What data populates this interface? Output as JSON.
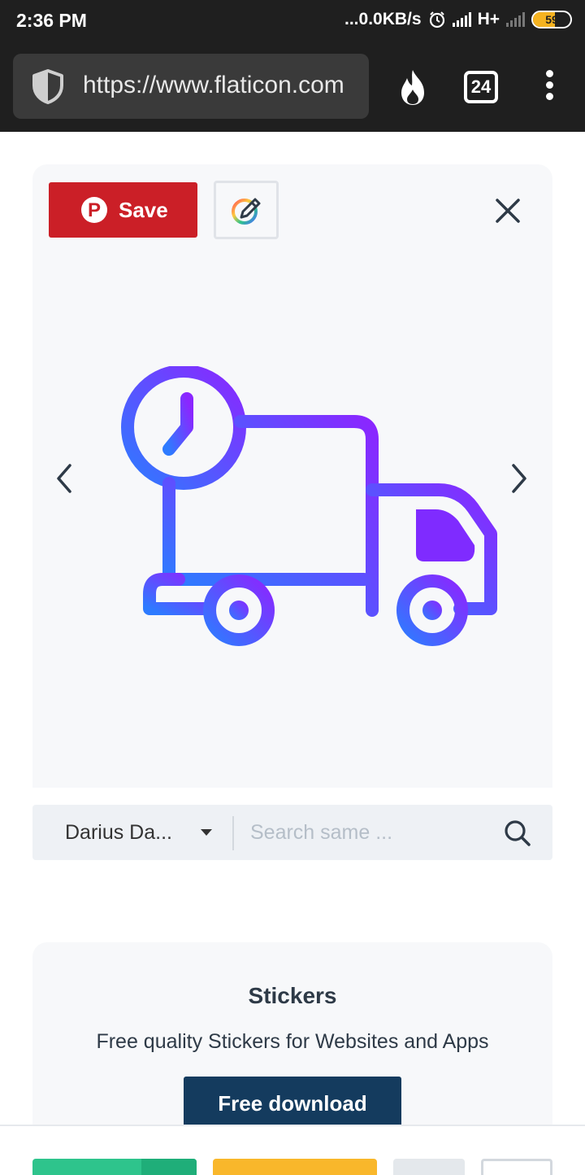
{
  "status_bar": {
    "time": "2:36 PM",
    "network_speed": "...0.0KB/s",
    "network_type": "H+",
    "battery_level": "59",
    "battery_fraction": 0.59
  },
  "browser": {
    "url": "https://www.flaticon.com",
    "tab_count": "24",
    "icons": [
      "shield-icon",
      "fire-icon",
      "tabs-icon",
      "menu-icon"
    ]
  },
  "preview": {
    "save_label": "Save",
    "colors": {
      "save_bg": "#cb1f27",
      "gradient_start": "#2e7bff",
      "gradient_end": "#8b26ff"
    },
    "icon": "fast-delivery-truck-icon"
  },
  "search": {
    "author": "Darius Da...",
    "placeholder": "Search same ..."
  },
  "stickers_promo": {
    "title": "Stickers",
    "subtitle": "Free quality Stickers for Websites and Apps",
    "button_label": "Free download"
  }
}
